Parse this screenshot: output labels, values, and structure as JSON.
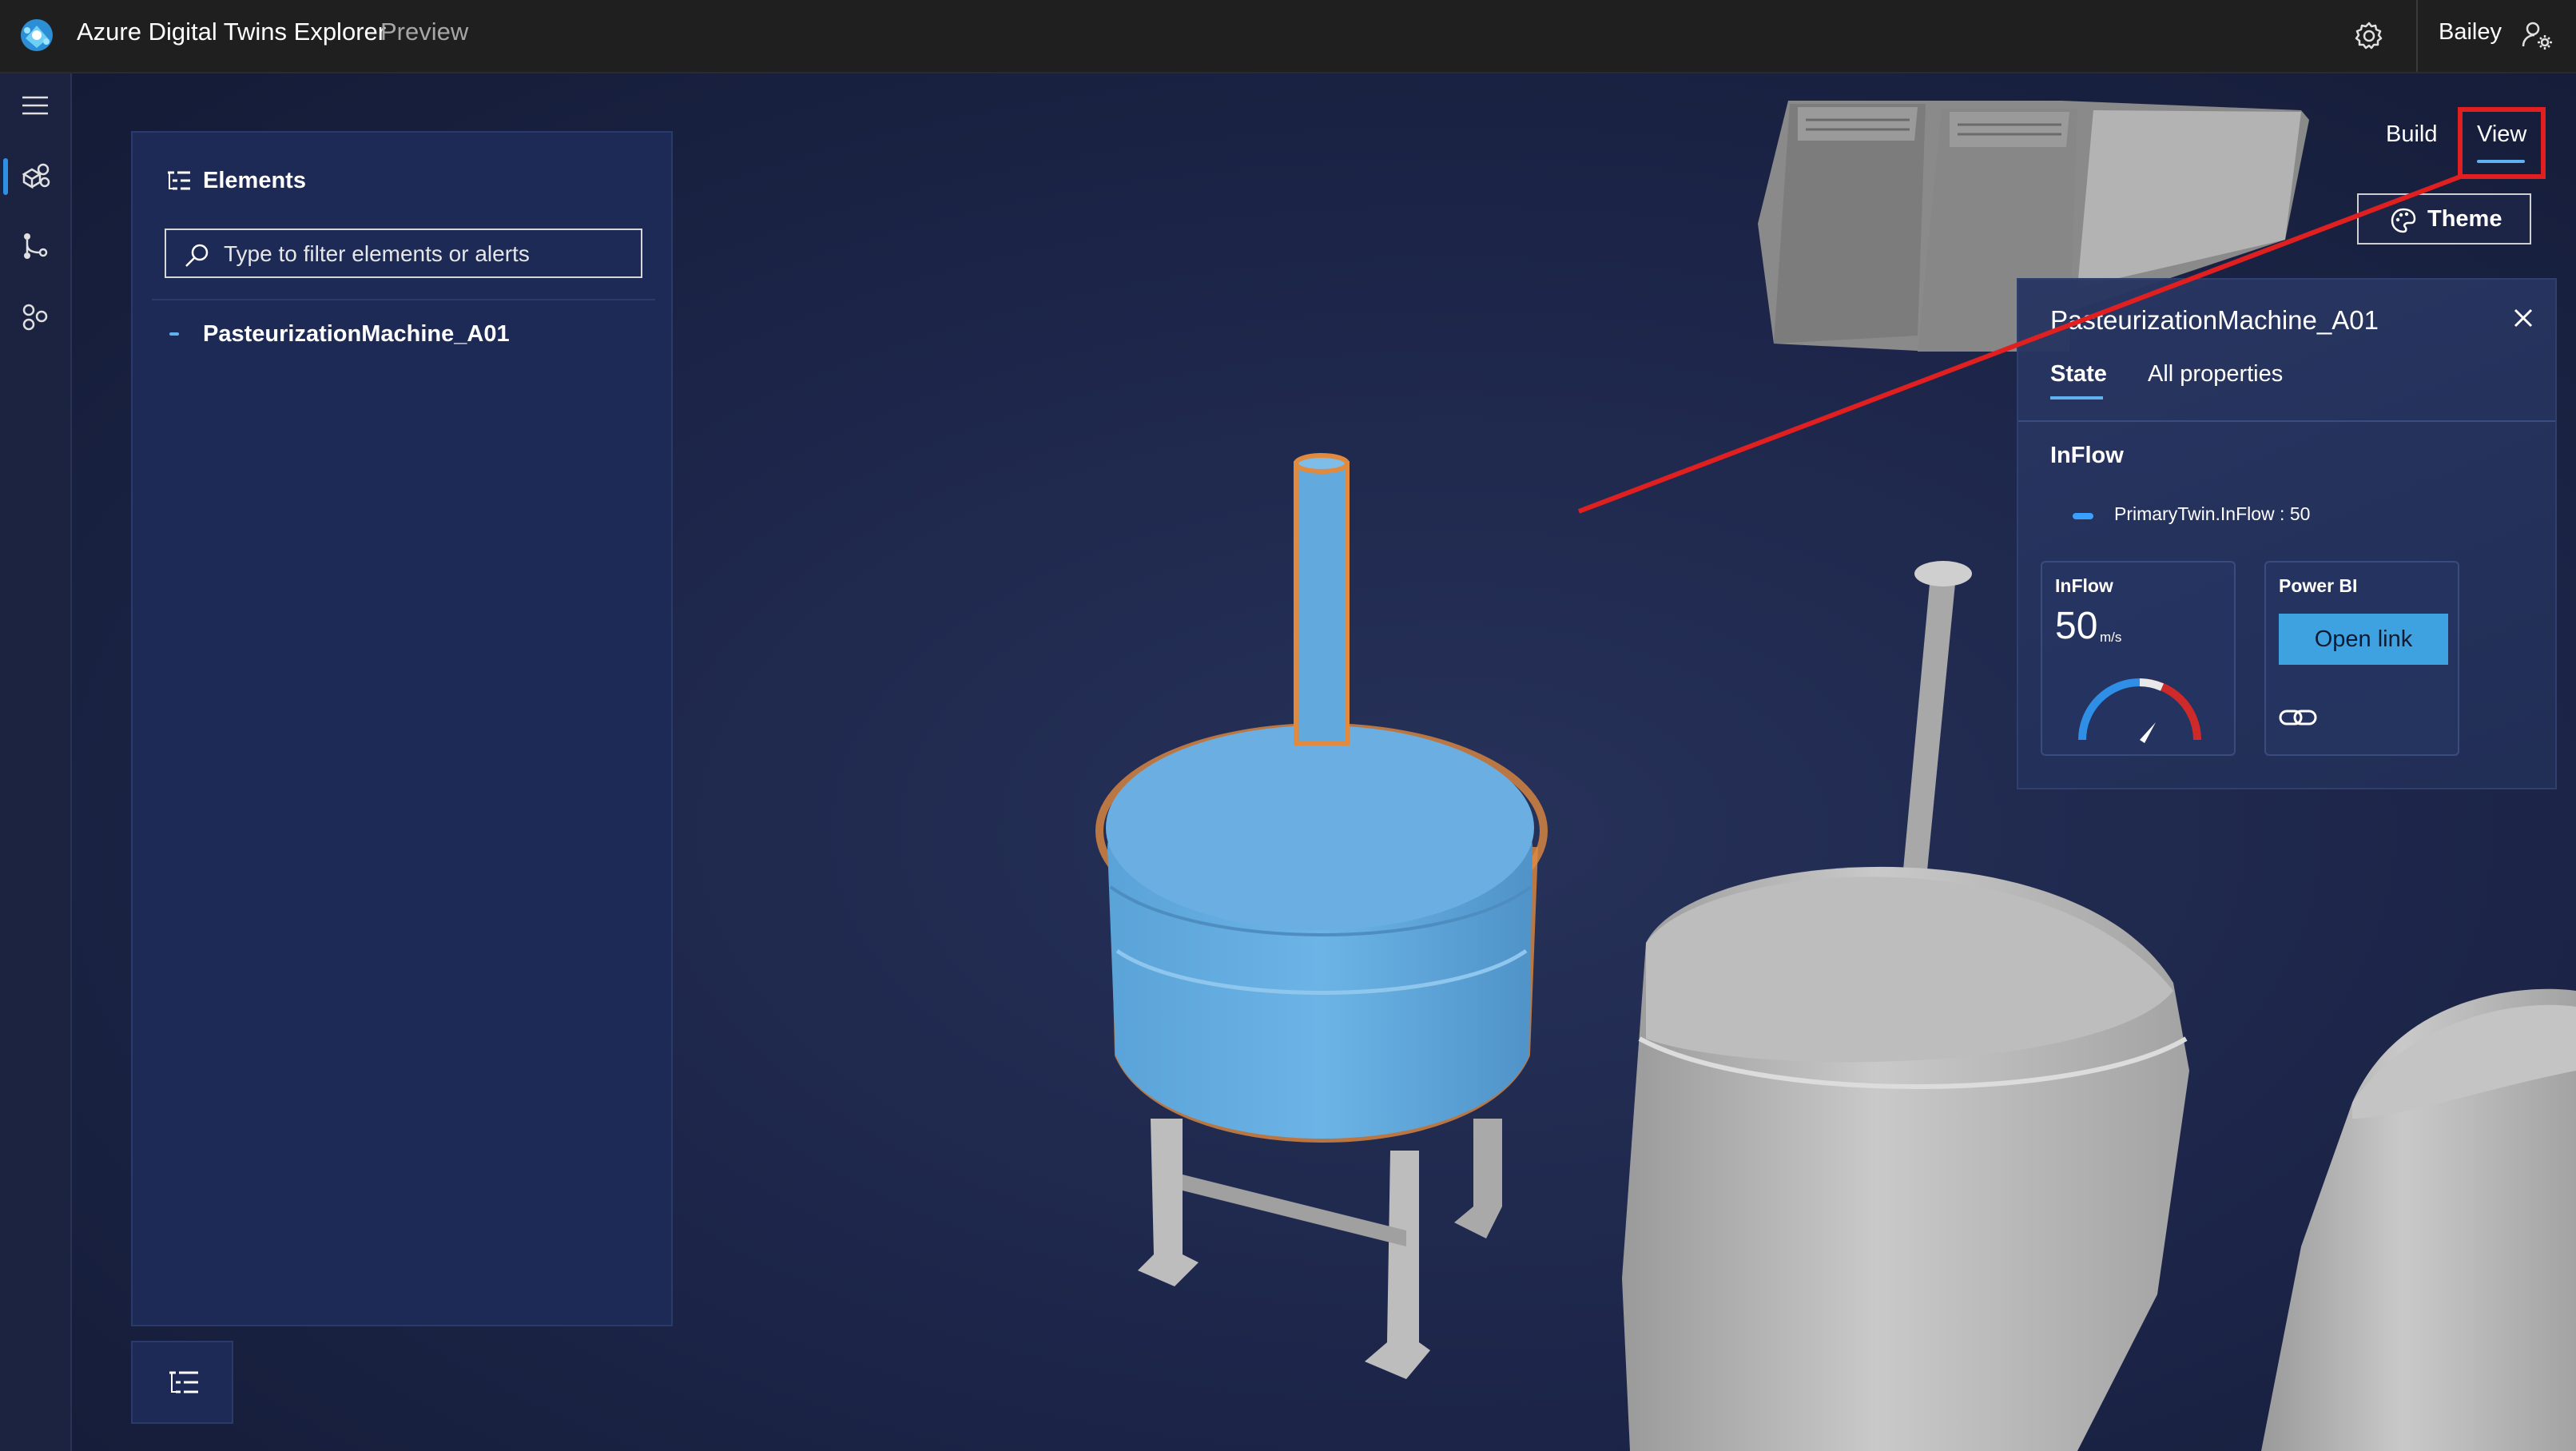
{
  "app": {
    "title": "Azure Digital Twins Explorer",
    "subtitle": "Preview",
    "user_name": "Bailey"
  },
  "left_nav": {
    "items": [
      {
        "icon": "3d-scene-icon",
        "active": true
      },
      {
        "icon": "twin-graph-icon",
        "active": false
      },
      {
        "icon": "models-icon",
        "active": false
      }
    ]
  },
  "elements_panel": {
    "title": "Elements",
    "search_placeholder": "Type to filter elements or alerts",
    "items": [
      {
        "label": "PasteurizationMachine_A01"
      }
    ]
  },
  "mode_toggle": {
    "build": "Build",
    "view": "View",
    "selected": "View"
  },
  "theme_button": {
    "label": "Theme"
  },
  "popover": {
    "title": "PasteurizationMachine_A01",
    "tabs": [
      "State",
      "All properties"
    ],
    "active_tab": "State",
    "section": "InFlow",
    "status_line": "PrimaryTwin.InFlow : 50",
    "cards": {
      "inflow": {
        "title": "InFlow",
        "value": "50",
        "unit": "m/s",
        "gauge_fraction": 0.5
      },
      "powerbi": {
        "title": "Power BI",
        "button": "Open link"
      }
    }
  },
  "colors": {
    "accent": "#5fb2ef",
    "highlight": "#e02020",
    "selected_tank": "#63ade0",
    "other_tanks": "#c8c8c8",
    "button": "#3fa2e0"
  }
}
